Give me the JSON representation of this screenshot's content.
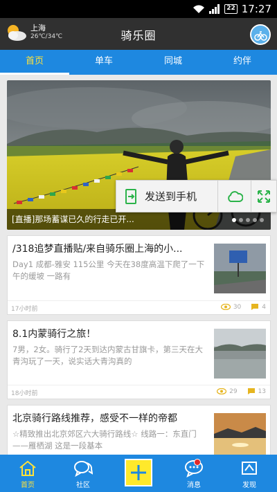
{
  "status_bar": {
    "time": "17:27",
    "battery": "22"
  },
  "header": {
    "title": "骑乐圈",
    "weather": {
      "city": "上海",
      "temp": "26℃/34℃"
    }
  },
  "tabs": [
    {
      "label": "首页",
      "active": true
    },
    {
      "label": "单车",
      "active": false
    },
    {
      "label": "同城",
      "active": false
    },
    {
      "label": "约伴",
      "active": false
    }
  ],
  "banner": {
    "caption": "[直播]那场蓄谋已久的行走已开..."
  },
  "share_popup": {
    "send_label": "发送到手机"
  },
  "posts": [
    {
      "title": "/318追梦直播贴/来自骑乐圈上海的小...",
      "desc": "Day1 成都-雅安 115公里    今天在38度高温下爬了一下午的缓坡 一路有",
      "time": "17小时前",
      "views": "30",
      "comments": "4"
    },
    {
      "title": "8.1内蒙骑行之旅！",
      "desc": "7男，2女。骑行了2天到达内蒙古甘旗卡，第三天在大青沟玩了一天，说实话大青沟真的",
      "time": "18小时前",
      "views": "29",
      "comments": "13"
    },
    {
      "title": "北京骑行路线推荐，感受不一样的帝都",
      "desc": "☆精致推出北京郊区六大骑行路线☆  线路一：东直门——雁栖湖    这是一段基本",
      "time": "",
      "views": "",
      "comments": ""
    }
  ],
  "bottom_nav": [
    {
      "label": "首页",
      "icon": "home-icon",
      "active": true
    },
    {
      "label": "社区",
      "icon": "chat-bubbles-icon",
      "active": false
    },
    {
      "label": "",
      "icon": "plus-icon",
      "active": false
    },
    {
      "label": "消息",
      "icon": "message-icon",
      "active": false
    },
    {
      "label": "发现",
      "icon": "discover-icon",
      "active": false
    }
  ],
  "colors": {
    "accent": "#1e88e0",
    "highlight": "#ffe23a",
    "header": "#303030"
  }
}
